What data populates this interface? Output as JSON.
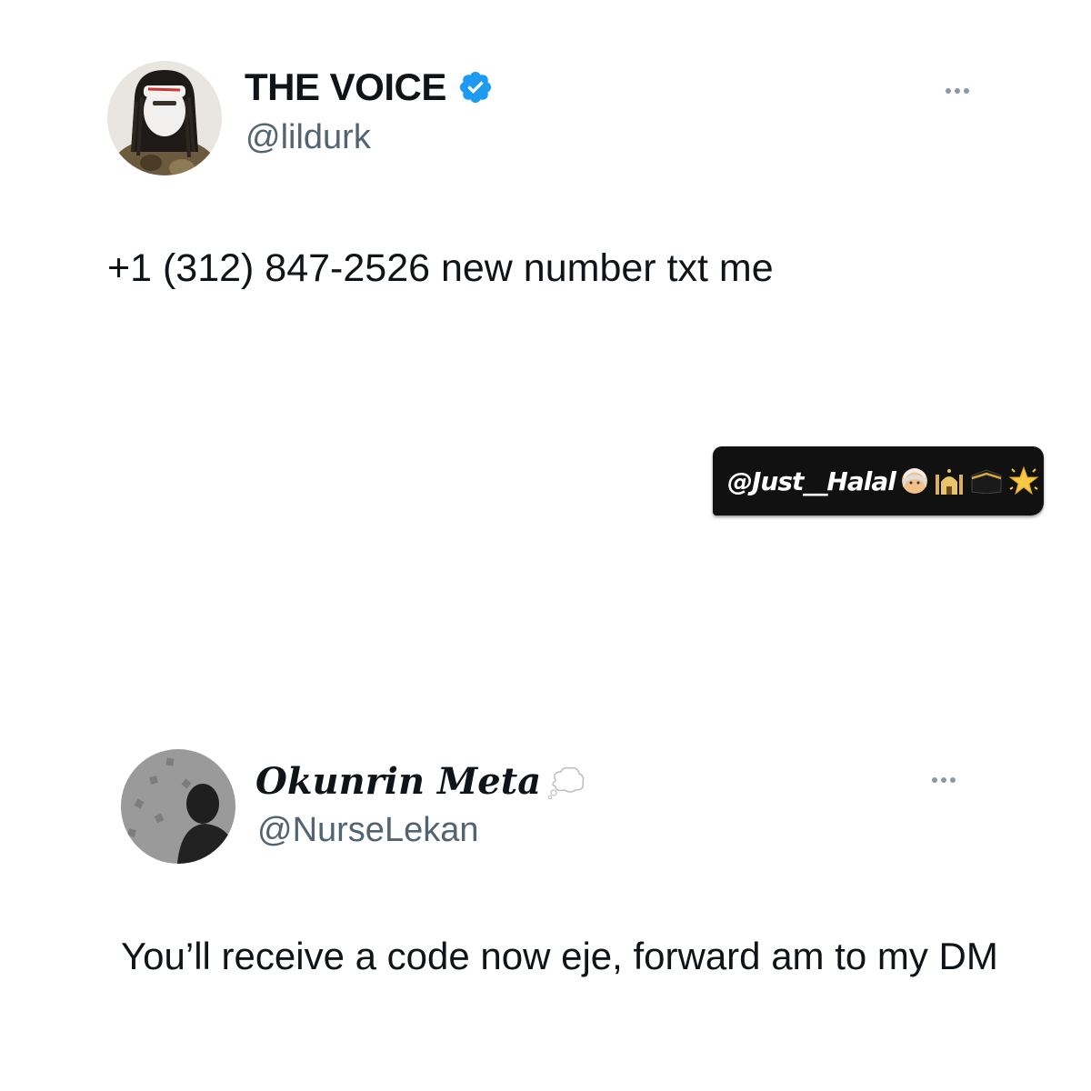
{
  "tweets": [
    {
      "display_name": "THE VOICE",
      "handle": "@lildurk",
      "verified": true,
      "verified_color": "#1d9bf0",
      "text": "+1 (312) 847-2526 new number txt me",
      "avatar_icon": "profile-photo-icon"
    },
    {
      "display_name": "Okunrin Meta",
      "name_emoji": "thought-balloon-icon",
      "handle": "@NurseLekan",
      "verified": false,
      "text": "You’ll receive a code now eje, forward am to my DM",
      "avatar_icon": "profile-photo-icon"
    }
  ],
  "watermark": {
    "text": "@Just__Halal",
    "emojis": [
      "person-icon",
      "mosque-icon",
      "kaaba-icon",
      "sparkle-star-icon"
    ],
    "background": "#111111"
  },
  "colors": {
    "text": "#0f1419",
    "secondary": "#536471",
    "more_dots": "#8b98a5"
  }
}
